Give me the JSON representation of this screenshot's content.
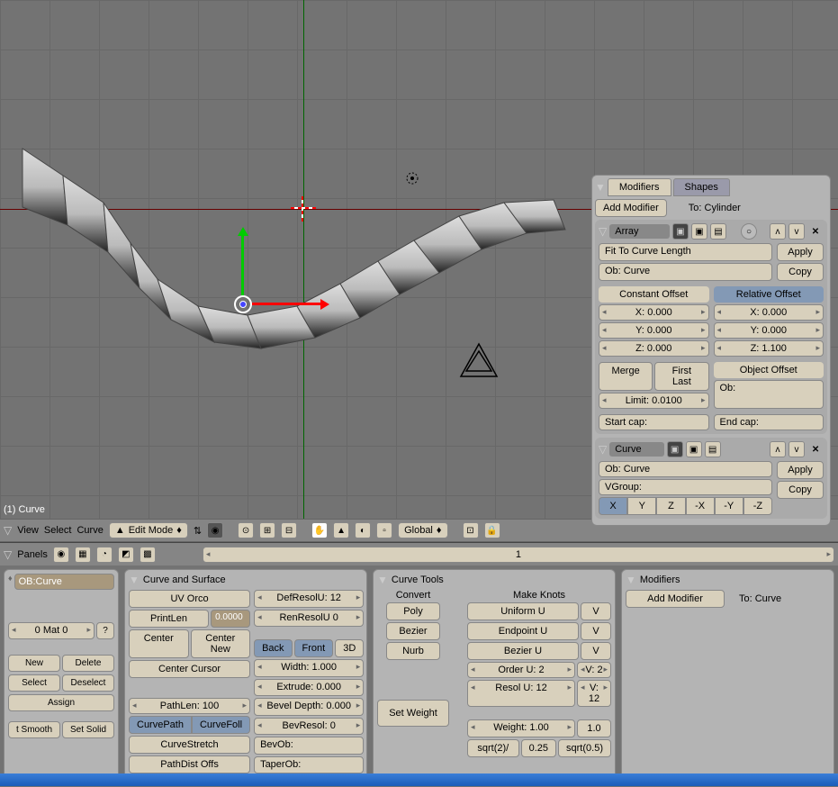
{
  "viewport": {
    "label": "(1) Curve"
  },
  "modifierPanel": {
    "tabs": {
      "modifiers": "Modifiers",
      "shapes": "Shapes"
    },
    "addModifier": "Add Modifier",
    "toLabel": "To: Cylinder",
    "array": {
      "name": "Array",
      "fitType": "Fit To Curve Length",
      "obCurve": "Ob: Curve",
      "apply": "Apply",
      "copy": "Copy",
      "constant": {
        "header": "Constant Offset",
        "x": "X: 0.000",
        "y": "Y: 0.000",
        "z": "Z: 0.000"
      },
      "relative": {
        "header": "Relative Offset",
        "x": "X: 0.000",
        "y": "Y: 0.000",
        "z": "Z: 1.100"
      },
      "merge": "Merge",
      "firstLast": "First Last",
      "limit": "Limit: 0.0100",
      "objOffset": "Object Offset",
      "ob": "Ob:",
      "startCap": "Start cap:",
      "endCap": "End cap:"
    },
    "curve": {
      "name": "Curve",
      "apply": "Apply",
      "copy": "Copy",
      "ob": "Ob: Curve",
      "vgroup": "VGroup:",
      "axes": [
        "X",
        "Y",
        "Z",
        "-X",
        "-Y",
        "-Z"
      ]
    }
  },
  "viewHeader": {
    "view": "View",
    "select": "Select",
    "curve": "Curve",
    "modeLabel": "Edit Mode",
    "global": "Global"
  },
  "panelsHeader": {
    "label": "Panels",
    "pageNum": "1"
  },
  "editPanel": {
    "obCurve": "OB:Curve",
    "matBtn": "0 Mat 0",
    "matQ": "?",
    "new": "New",
    "delete": "Delete",
    "select": "Select",
    "deselect": "Deselect",
    "assign": "Assign",
    "setSmooth": "t Smooth",
    "setSolid": "Set Solid"
  },
  "curveSurface": {
    "title": "Curve and Surface",
    "uvOrco": "UV Orco",
    "printLen": "PrintLen",
    "printLenVal": "0.0000",
    "center": "Center",
    "centerNew": "Center New",
    "centerCursor": "Center Cursor",
    "pathLen": "PathLen: 100",
    "curvePath": "CurvePath",
    "curveFoll": "CurveFoll",
    "curveStretch": "CurveStretch",
    "pathDistOffs": "PathDist Offs",
    "defResolU": "DefResolU: 12",
    "renResolU": "RenResolU 0",
    "back": "Back",
    "front": "Front",
    "threeD": "3D",
    "width": "Width: 1.000",
    "extrude": "Extrude: 0.000",
    "bevelDepth": "Bevel Depth: 0.000",
    "bevResol": "BevResol: 0",
    "bevOb": "BevOb:",
    "taperOb": "TaperOb:"
  },
  "curveTools": {
    "title": "Curve Tools",
    "convert": "Convert",
    "makeKnots": "Make Knots",
    "poly": "Poly",
    "bezier": "Bezier",
    "nurb": "Nurb",
    "uniformU": "Uniform U",
    "v1": "V",
    "endpointU": "Endpoint U",
    "v2": "V",
    "bezierU": "Bezier U",
    "v3": "V",
    "orderU": "Order U: 2",
    "orderV": "V: 2",
    "resolU": "Resol U: 12",
    "resolV": "V: 12",
    "setWeight": "Set Weight",
    "weight": "Weight: 1.00",
    "one": "1.0",
    "sqrt2": "sqrt(2)/",
    "p25": "0.25",
    "sqrt05": "sqrt(0.5)"
  },
  "bottomMod": {
    "title": "Modifiers",
    "addModifier": "Add Modifier",
    "toLabel": "To: Curve"
  }
}
